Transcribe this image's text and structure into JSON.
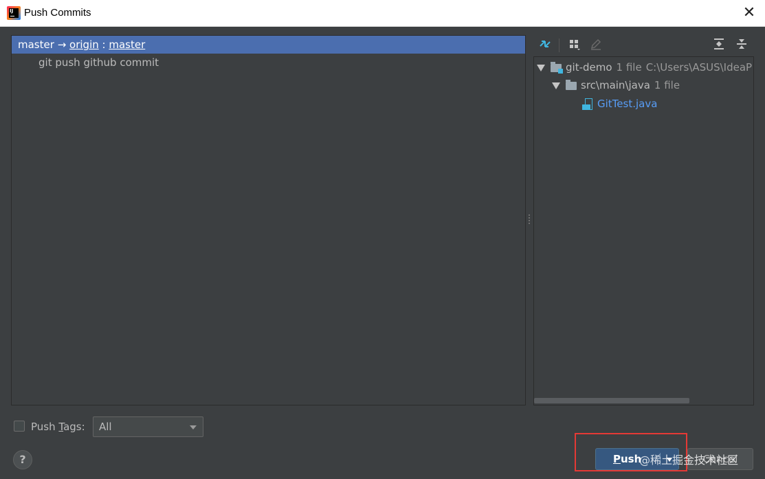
{
  "window": {
    "title": "Push Commits",
    "close_glyph": "✕"
  },
  "commits": {
    "branch": {
      "local": "master",
      "arrow": "→",
      "remote": "origin",
      "colon": " : ",
      "remote_branch": "master"
    },
    "items": [
      {
        "message": "git push github commit"
      }
    ]
  },
  "toolbar": {
    "icons": [
      "compare-icon",
      "group-by-icon",
      "edit-icon",
      "expand-all-icon",
      "collapse-all-icon"
    ]
  },
  "tree": {
    "root": {
      "name": "git-demo",
      "count": "1 file",
      "path": "C:\\Users\\ASUS\\IdeaP"
    },
    "folder": {
      "name": "src\\main\\java",
      "count": "1 file"
    },
    "file": {
      "name": "GitTest.java"
    }
  },
  "footer": {
    "push_tags": {
      "label_pre": "Push ",
      "label_underlined": "T",
      "label_post": "ags:",
      "checked": false
    },
    "tags_select": {
      "value": "All"
    },
    "help_label": "?",
    "push_button": {
      "underlined": "P",
      "rest": "ush"
    },
    "cancel_button": "Cancel",
    "watermark": "@稀土掘金技术社区"
  },
  "colors": {
    "selection": "#4b6eaf",
    "panel_bg": "#3c3f41",
    "link_blue": "#589df6",
    "highlight_red": "#e53935"
  }
}
